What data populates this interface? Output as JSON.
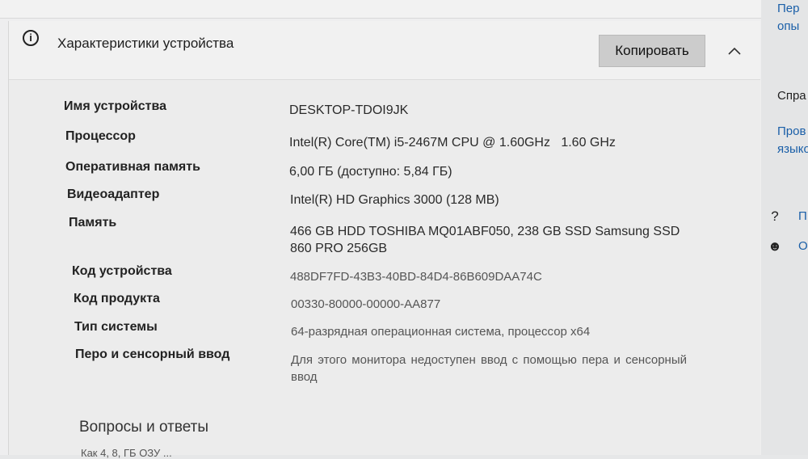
{
  "card": {
    "title": "Характеристики устройства",
    "copy_label": "Копировать",
    "info_icon": "i",
    "collapse_icon": "^"
  },
  "specs": [
    {
      "label": "Имя устройства",
      "value": "DESKTOP-TDOI9JK"
    },
    {
      "label": "Процессор",
      "value": "Intel(R) Core(TM) i5-2467M CPU @ 1.60GHz   1.60 GHz"
    },
    {
      "label": "Оперативная память",
      "value": "6,00 ГБ (доступно: 5,84 ГБ)"
    },
    {
      "label": "Видеоадаптер",
      "value": "Intel(R) HD Graphics 3000 (128 MB)"
    },
    {
      "label": "Память",
      "value": "466 GB HDD TOSHIBA MQ01ABF050, 238 GB SSD Samsung SSD 860 PRO 256GB"
    },
    {
      "label": "Код устройства",
      "value": "488DF7FD-43B3-40BD-84D4-86B609DAA74C"
    },
    {
      "label": "Код продукта",
      "value": "00330-80000-00000-AA877"
    },
    {
      "label": "Тип системы",
      "value": "64-разрядная операционная система, процессор x64"
    },
    {
      "label": "Перо и сенсорный ввод",
      "value": "Для этого монитора недоступен ввод с помощью пера и сенсорный ввод"
    }
  ],
  "faq": {
    "title": "Вопросы и ответы",
    "first_line": "Как 4, 8, ГБ ОЗУ ..."
  },
  "side": {
    "link1_line1": "Пер",
    "link1_line2": "опы",
    "heading": "Спра",
    "link2_line1": "Пров",
    "link2_line2": "языко",
    "help_icon": "?",
    "help_text": "П",
    "feedback_icon": "☻",
    "feedback_text": "О"
  }
}
